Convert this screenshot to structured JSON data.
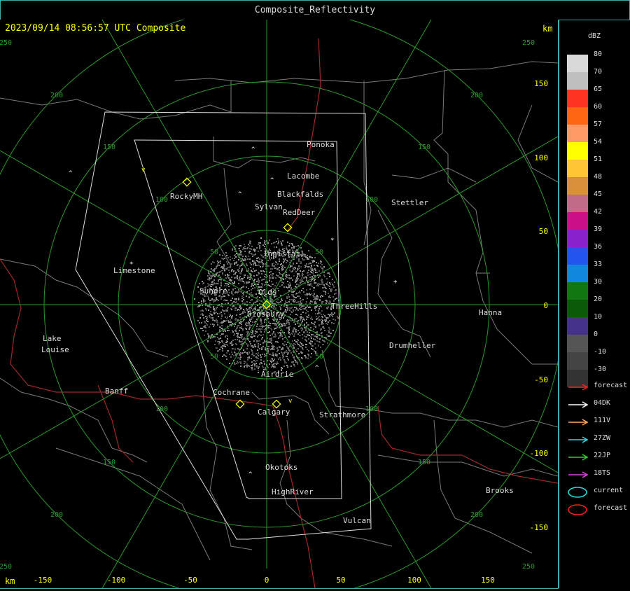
{
  "window": {
    "title": "Composite_Reflectivity"
  },
  "header": {
    "timestamp": "2023/09/14 08:56:57 UTC Composite",
    "km_top_right": "km",
    "km_bottom_left": "km"
  },
  "colors": {
    "grid": "#2a9a2a",
    "yellow": "#ffff00",
    "boundary": "#888888",
    "river": "#b33333",
    "frame": "#44aaaa"
  },
  "axes": {
    "x_ticks": [
      "-150",
      "-100",
      "-50",
      "0",
      "50",
      "100",
      "150"
    ],
    "y_ticks": [
      "150",
      "100",
      "50",
      "0",
      "-50",
      "-100",
      "-150"
    ]
  },
  "range_ring_labels": [
    "50",
    "100",
    "150",
    "200",
    "250"
  ],
  "towns": [
    {
      "name": "Ponoka"
    },
    {
      "name": "Lacombe"
    },
    {
      "name": "Blackfalds"
    },
    {
      "name": "Sylvan"
    },
    {
      "name": "RedDeer"
    },
    {
      "name": "RockyMH"
    },
    {
      "name": "Stettler"
    },
    {
      "name": "Innisfail"
    },
    {
      "name": "Limestone"
    },
    {
      "name": "Sundre"
    },
    {
      "name": "Olds"
    },
    {
      "name": "ThreeHills"
    },
    {
      "name": "Didsbury"
    },
    {
      "name": "Hanna"
    },
    {
      "name": "Lake"
    },
    {
      "name": "Louise"
    },
    {
      "name": "Drumheller"
    },
    {
      "name": "Airdrie"
    },
    {
      "name": "Banff"
    },
    {
      "name": "Cochrane"
    },
    {
      "name": "Calgary"
    },
    {
      "name": "Strathmore"
    },
    {
      "name": "Okotoks"
    },
    {
      "name": "HighRiver"
    },
    {
      "name": "Brooks"
    },
    {
      "name": "Vulcan"
    }
  ],
  "legend": {
    "title": "dBZ",
    "scale": [
      {
        "label": "80",
        "color": "#d9d9d9"
      },
      {
        "label": "70",
        "color": "#bfbfbf"
      },
      {
        "label": "65",
        "color": "#ff3322"
      },
      {
        "label": "60",
        "color": "#ff6611"
      },
      {
        "label": "57",
        "color": "#ff9966"
      },
      {
        "label": "54",
        "color": "#ffff00"
      },
      {
        "label": "51",
        "color": "#ffc633"
      },
      {
        "label": "48",
        "color": "#d8903a"
      },
      {
        "label": "45",
        "color": "#c06b88"
      },
      {
        "label": "42",
        "color": "#cc1188"
      },
      {
        "label": "39",
        "color": "#8822cc"
      },
      {
        "label": "36",
        "color": "#2255ee"
      },
      {
        "label": "33",
        "color": "#1188dd"
      },
      {
        "label": "30",
        "color": "#117711"
      },
      {
        "label": "20",
        "color": "#0a5a0a"
      },
      {
        "label": "10",
        "color": "#443388"
      },
      {
        "label": "0",
        "color": "#555555"
      },
      {
        "label": "-10",
        "color": "#444444"
      },
      {
        "label": "-30",
        "color": "#333333"
      }
    ],
    "tracks": [
      {
        "label": "forecast",
        "color": "#ff2222",
        "kind": "arrow"
      },
      {
        "label": "04DK",
        "color": "#ffffff",
        "kind": "arrow"
      },
      {
        "label": "111V",
        "color": "#ffaa66",
        "kind": "arrow"
      },
      {
        "label": "27ZW",
        "color": "#33dddd",
        "kind": "arrow"
      },
      {
        "label": "22JP",
        "color": "#33cc33",
        "kind": "arrow"
      },
      {
        "label": "18TS",
        "color": "#dd44dd",
        "kind": "arrow"
      },
      {
        "label": "current",
        "color": "#22dddd",
        "kind": "ellipse"
      },
      {
        "label": "forecast",
        "color": "#ee2222",
        "kind": "ellipse"
      }
    ]
  }
}
